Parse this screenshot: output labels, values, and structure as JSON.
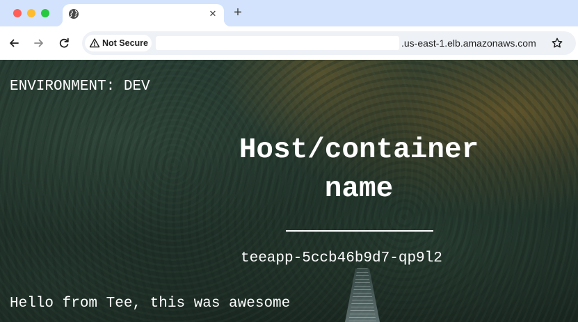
{
  "browser": {
    "tab": {
      "title": "",
      "close_glyph": "✕",
      "icon": "globe-icon"
    },
    "new_tab_glyph": "+",
    "nav": {
      "back_icon": "back-arrow-icon",
      "forward_icon": "forward-arrow-icon",
      "reload_icon": "reload-icon"
    },
    "address_bar": {
      "security_label": "Not Secure",
      "security_icon": "warning-triangle-icon",
      "url_visible_suffix": ".us-east-1.elb.amazonaws.com",
      "bookmark_icon": "star-icon"
    }
  },
  "page": {
    "environment": "ENVIRONMENT: DEV",
    "title": "Host/container name",
    "hostname": "teeapp-5ccb46b9d7-qp9l2",
    "greeting": "Hello from Tee, this was awesome"
  },
  "colors": {
    "tab_strip": "#d3e3fd",
    "toolbar": "#ffffff",
    "omnibox": "#eef1f6",
    "page_text": "#ffffff",
    "background_forest": "#1d2d26"
  }
}
